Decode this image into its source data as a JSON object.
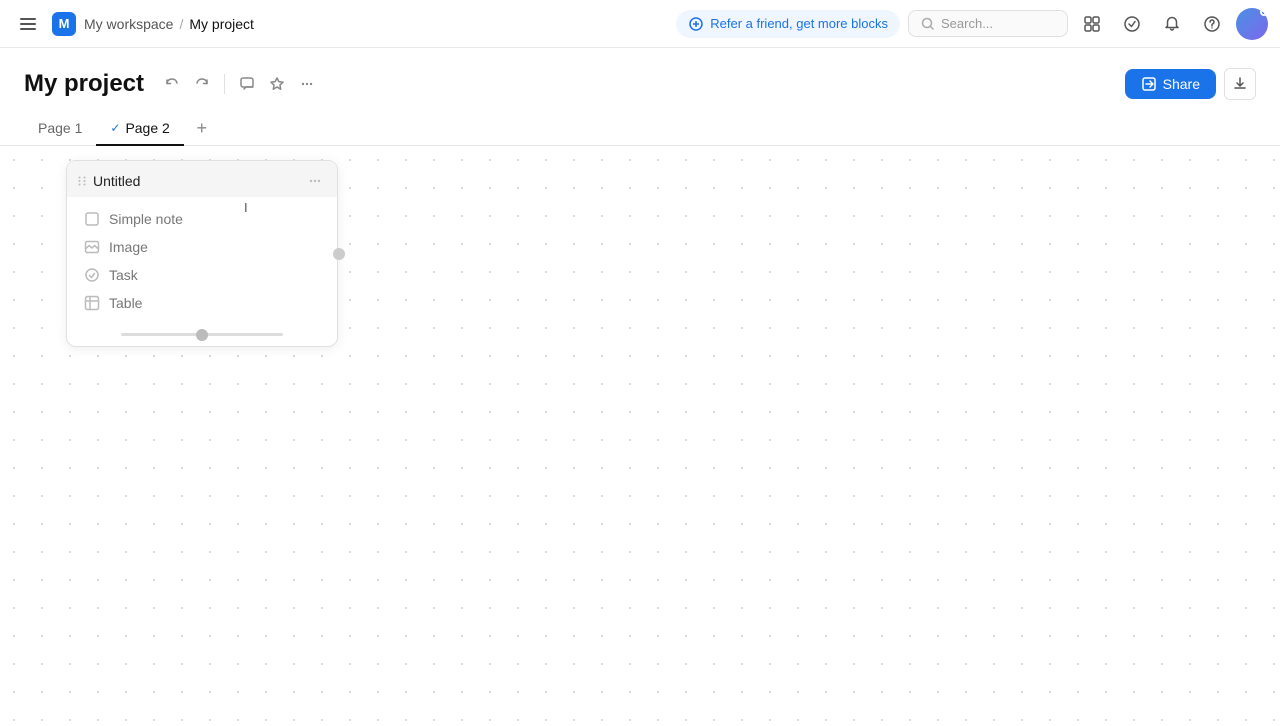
{
  "topnav": {
    "workspace_logo": "M",
    "workspace_name": "My workspace",
    "breadcrumb_sep": "/",
    "project_name": "My project",
    "refer_label": "Refer a friend, get more blocks",
    "search_placeholder": "Search...",
    "icons": {
      "menu": "☰",
      "search": "🔍",
      "template": "⊡",
      "check": "✓",
      "bell": "🔔",
      "help": "?"
    }
  },
  "page": {
    "title": "My project",
    "actions": {
      "undo": "↩",
      "redo": "↪",
      "comment": "💬",
      "star": "☆",
      "more": "•••"
    },
    "share_label": "Share",
    "export_icon": "⬇"
  },
  "tabs": [
    {
      "id": "page1",
      "label": "Page 1",
      "active": false,
      "checked": false
    },
    {
      "id": "page2",
      "label": "Page 2",
      "active": true,
      "checked": true
    }
  ],
  "add_tab_label": "+",
  "canvas": {
    "card": {
      "drag_icon": "⠿",
      "title": "Untitled",
      "menu_dots": "•••",
      "items": [
        {
          "id": "simple-note",
          "icon": "☐",
          "label": "Simple note"
        },
        {
          "id": "image",
          "icon": "⊟",
          "label": "Image"
        },
        {
          "id": "task",
          "icon": "⊙",
          "label": "Task"
        },
        {
          "id": "table",
          "icon": "⊞",
          "label": "Table"
        }
      ]
    }
  }
}
